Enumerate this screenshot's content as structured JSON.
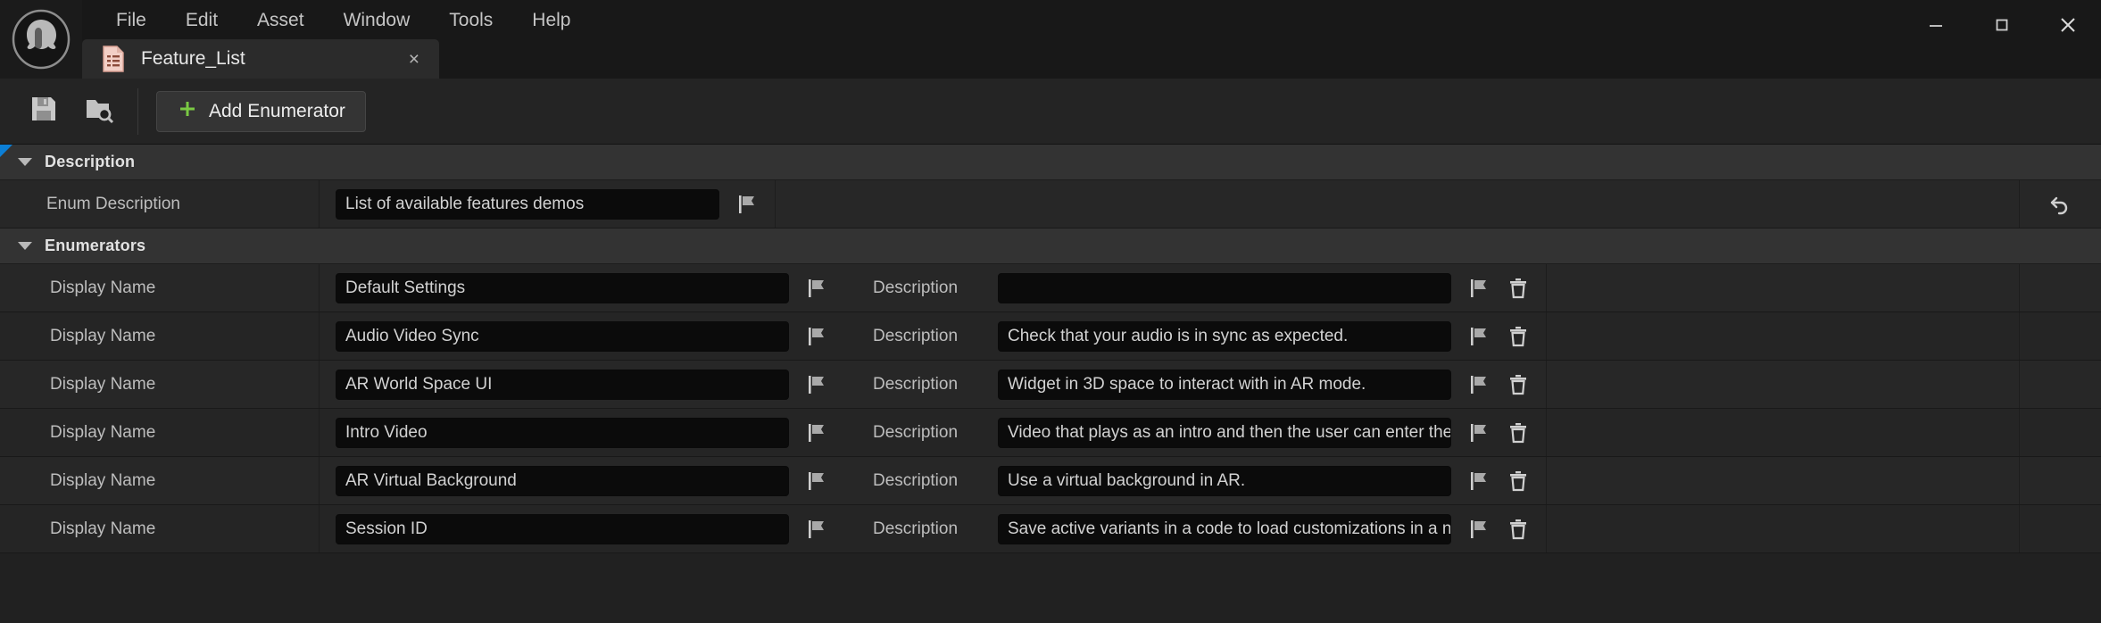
{
  "window": {
    "logo_icon": "unreal-engine-logo",
    "menus": [
      "File",
      "Edit",
      "Asset",
      "Window",
      "Tools",
      "Help"
    ],
    "controls": {
      "minimize_icon": "minimize-icon",
      "maximize_icon": "maximize-icon",
      "close_icon": "close-icon"
    }
  },
  "tab": {
    "icon": "enum-asset-icon",
    "title": "Feature_List",
    "close_glyph": "×"
  },
  "toolbar": {
    "save_icon": "save-icon",
    "browse_icon": "browse-content-icon",
    "add_enumerator_label": "Add Enumerator",
    "add_icon": "plus-icon",
    "add_icon_color": "#7ac943"
  },
  "sections": {
    "description": {
      "title": "Description",
      "accent_color": "#0c7fd6",
      "rows": [
        {
          "label": "Enum Description",
          "value": "List of available features demos",
          "flag_icon": "flag-icon",
          "reset_icon": "revert-arrow-icon"
        }
      ]
    },
    "enumerators": {
      "title": "Enumerators",
      "name_label": "Display Name",
      "desc_label": "Description",
      "flag_icon": "flag-icon",
      "delete_icon": "trash-icon",
      "rows": [
        {
          "display_name": "Default Settings",
          "description": ""
        },
        {
          "display_name": "Audio Video Sync",
          "description": "Check that your audio is in sync as expected."
        },
        {
          "display_name": "AR World Space UI",
          "description": "Widget in 3D space to interact with in AR mode."
        },
        {
          "display_name": "Intro Video",
          "description": "Video that plays as an intro and then the user can enter the experience."
        },
        {
          "display_name": "AR Virtual Background",
          "description": "Use a virtual background in AR."
        },
        {
          "display_name": "Session ID",
          "description": "Save active variants in a code to load customizations in a new session."
        }
      ]
    }
  }
}
